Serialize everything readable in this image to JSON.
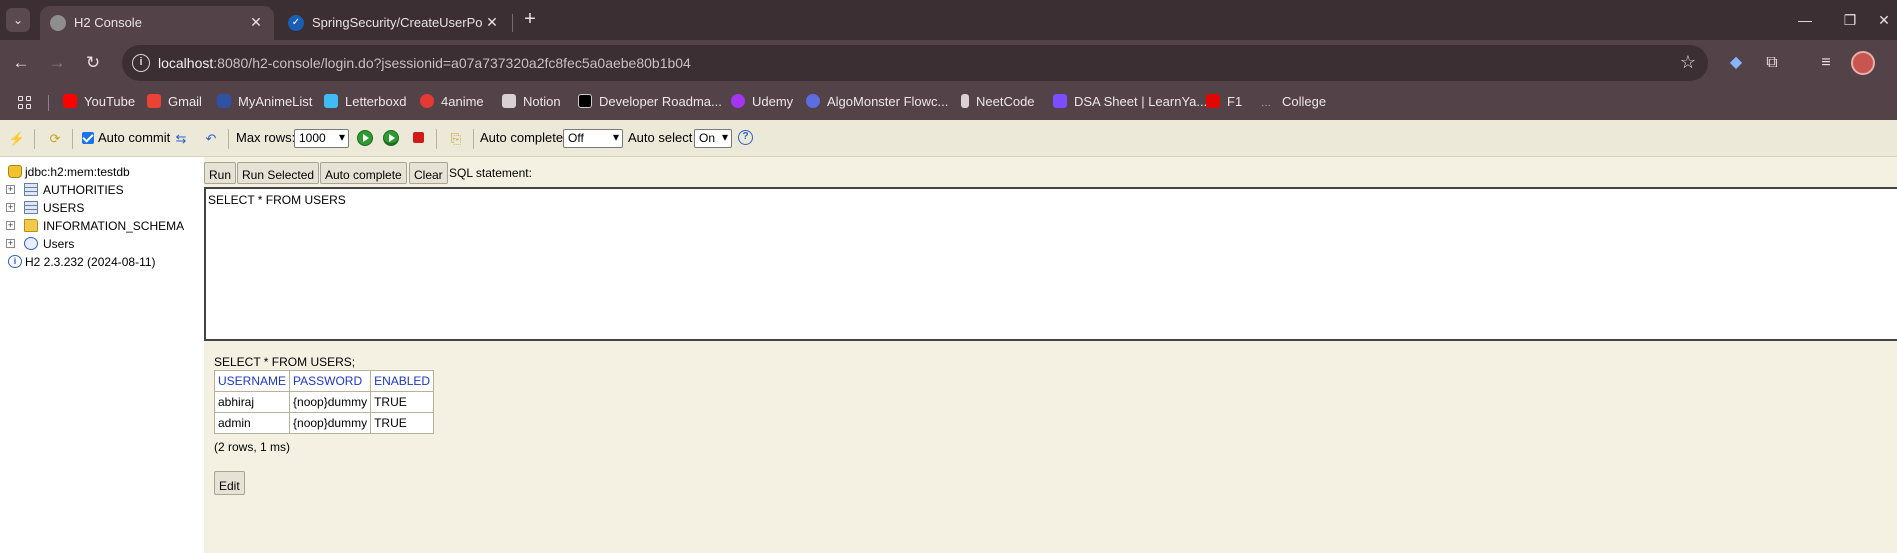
{
  "browser": {
    "tabs": [
      {
        "title": "H2 Console",
        "active": true
      },
      {
        "title": "SpringSecurity/CreateUserPostR",
        "active": false
      }
    ],
    "address": {
      "host": "localhost",
      "rest": ":8080/h2-console/login.do?jsessionid=a07a737320a2fc8fec5a0aebe80b1b04"
    },
    "bookmarks": [
      {
        "label": "YouTube",
        "icon": "youtube-icon",
        "color": "#ff0000"
      },
      {
        "label": "Gmail",
        "icon": "gmail-icon",
        "color": "#ea4335"
      },
      {
        "label": "MyAnimeList",
        "icon": "myanimelist-icon",
        "color": "#2e51a2"
      },
      {
        "label": "Letterboxd",
        "icon": "letterboxd-icon",
        "color": "#40bcf4"
      },
      {
        "label": "4anime",
        "icon": "4anime-icon",
        "color": "#e53935"
      },
      {
        "label": "Notion",
        "icon": "notion-icon",
        "color": "#ffffff"
      },
      {
        "label": "Developer Roadma...",
        "icon": "roadmap-icon",
        "color": "#000000"
      },
      {
        "label": "Udemy",
        "icon": "udemy-icon",
        "color": "#a435f0"
      },
      {
        "label": "AlgoMonster Flowc...",
        "icon": "algomonster-icon",
        "color": "#5b6ee1"
      },
      {
        "label": "NeetCode",
        "icon": "neetcode-icon",
        "color": "#ffffff"
      },
      {
        "label": "DSA Sheet | LearnYa...",
        "icon": "learnyard-icon",
        "color": "#7c4dff"
      },
      {
        "label": "F1",
        "icon": "f1-icon",
        "color": "#e10600"
      },
      {
        "label": "College",
        "icon": "college-icon",
        "color": "#9e9e9e"
      }
    ]
  },
  "h2": {
    "toolbar": {
      "auto_commit": "Auto commit",
      "max_rows_label": "Max rows:",
      "max_rows_value": "1000",
      "auto_complete_label": "Auto complete",
      "auto_complete_value": "Off",
      "auto_select_label": "Auto select",
      "auto_select_value": "On"
    },
    "tree": {
      "connection": "jdbc:h2:mem:testdb",
      "items": [
        "AUTHORITIES",
        "USERS",
        "INFORMATION_SCHEMA",
        "Users"
      ],
      "version": "H2 2.3.232 (2024-08-11)"
    },
    "buttons": {
      "run": "Run",
      "run_selected": "Run Selected",
      "auto_complete": "Auto complete",
      "clear": "Clear",
      "sql_statement": "SQL statement:"
    },
    "editor_text": "SELECT * FROM USERS",
    "result": {
      "query": "SELECT * FROM USERS;",
      "columns": [
        "USERNAME",
        "PASSWORD",
        "ENABLED"
      ],
      "rows": [
        [
          "abhiraj",
          "{noop}dummy",
          "TRUE"
        ],
        [
          "admin",
          "{noop}dummy",
          "TRUE"
        ]
      ],
      "summary": "(2 rows, 1 ms)",
      "edit": "Edit"
    }
  }
}
